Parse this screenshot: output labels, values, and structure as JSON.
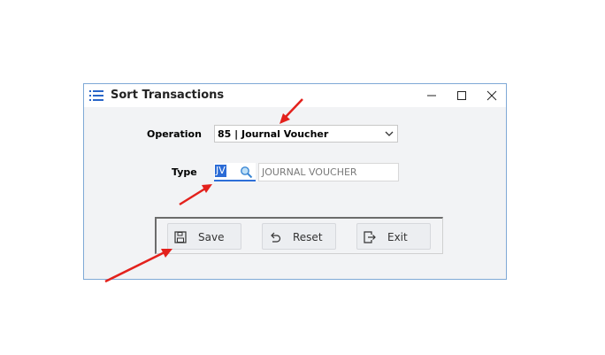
{
  "window": {
    "title": "Sort Transactions"
  },
  "form": {
    "operation_label": "Operation",
    "operation_value": "85 | Journal Voucher",
    "type_label": "Type",
    "type_code": "JV",
    "type_description": "JOURNAL VOUCHER"
  },
  "buttons": {
    "save": "Save",
    "reset": "Reset",
    "exit": "Exit"
  },
  "colors": {
    "accent": "#2b6bd6",
    "annotation_arrow": "#e3211c",
    "window_border": "#7fa9d6"
  }
}
